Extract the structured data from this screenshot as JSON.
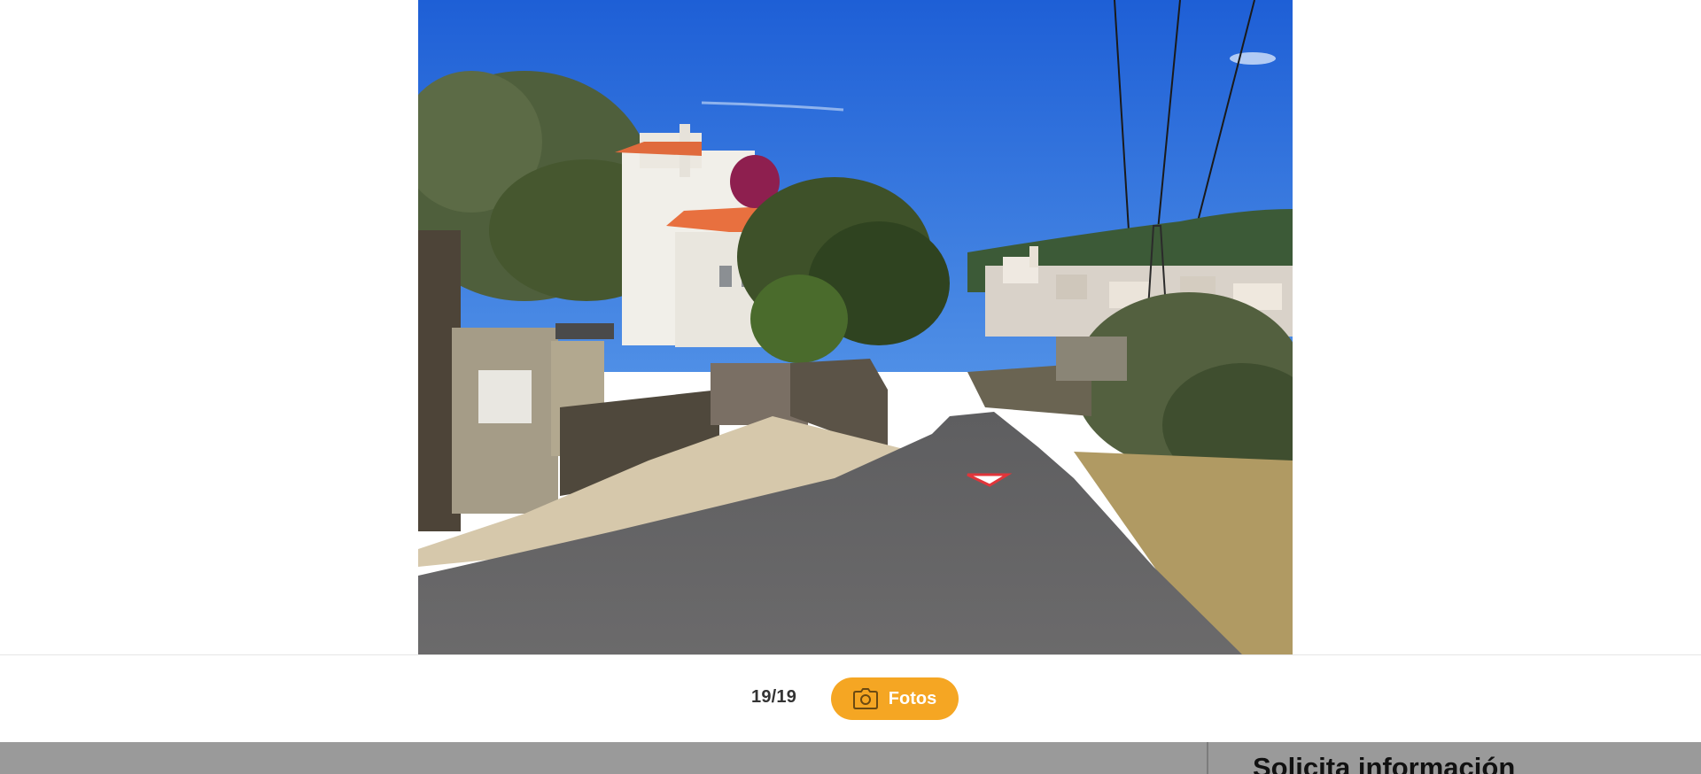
{
  "gallery": {
    "counter": "19/19",
    "photos_button_label": "Fotos",
    "photos_button_icon": "camera-icon",
    "accent_color": "#f5a623"
  },
  "sidebar": {
    "title": "Solicita información"
  }
}
